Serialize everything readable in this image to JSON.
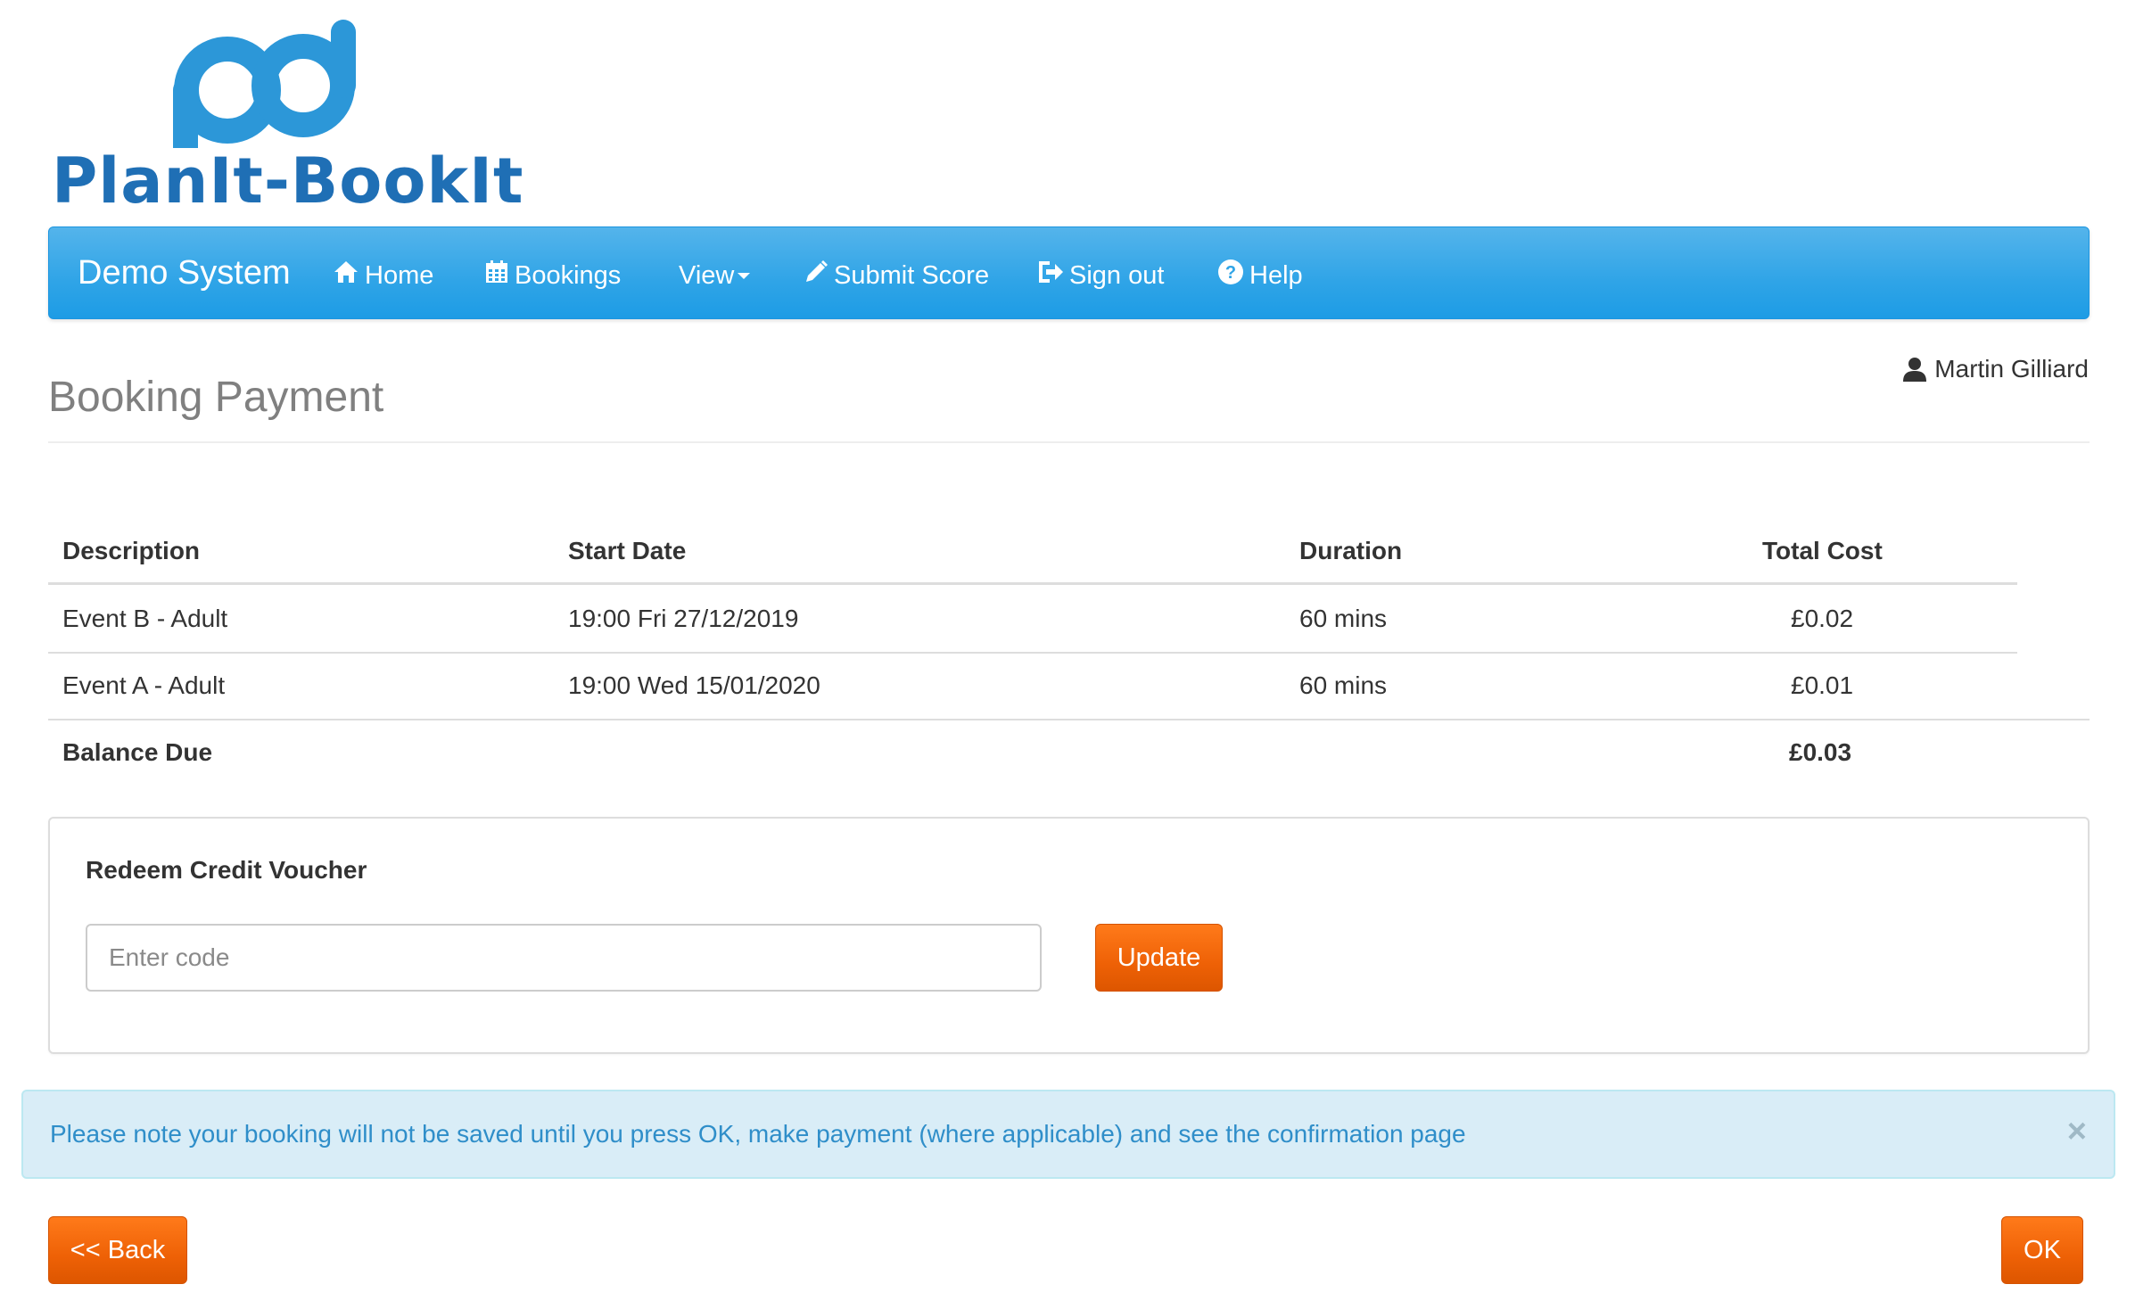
{
  "logo": {
    "text": "PlanIt-BookIt",
    "icon": "pb-logo-icon"
  },
  "colors": {
    "nav_bg": "#2fa4e7",
    "accent_orange": "#ee6106",
    "logo_blue": "#2c97d8",
    "alert_bg": "#d9edf7",
    "alert_text": "#2f8ec9"
  },
  "navbar": {
    "brand": "Demo System",
    "items": [
      {
        "label": "Home",
        "icon": "home-icon"
      },
      {
        "label": "Bookings",
        "icon": "calendar-icon"
      },
      {
        "label": "View",
        "icon": "caret-down-icon"
      },
      {
        "label": "Submit Score",
        "icon": "pencil-icon"
      },
      {
        "label": "Sign out",
        "icon": "sign-out-icon"
      },
      {
        "label": "Help",
        "icon": "help-icon"
      }
    ]
  },
  "header": {
    "title": "Booking Payment",
    "user_name": "Martin Gilliard",
    "user_icon": "user-icon"
  },
  "table": {
    "columns": [
      "Description",
      "Start Date",
      "Duration",
      "Total Cost"
    ],
    "rows": [
      {
        "description": "Event B - Adult",
        "start_date": "19:00 Fri 27/12/2019",
        "duration": "60 mins",
        "total_cost": "£0.02"
      },
      {
        "description": "Event A - Adult",
        "start_date": "19:00 Wed 15/01/2020",
        "duration": "60 mins",
        "total_cost": "£0.01"
      }
    ],
    "balance_label": "Balance Due",
    "balance_value": "£0.03"
  },
  "voucher": {
    "title": "Redeem Credit Voucher",
    "input_value": "",
    "placeholder": "Enter code",
    "button": "Update"
  },
  "alert": {
    "text": "Please note your booking will not be saved until you press OK, make payment (where applicable) and see the confirmation page",
    "close": "×"
  },
  "footer": {
    "back_label": "<< Back",
    "ok_label": "OK"
  }
}
